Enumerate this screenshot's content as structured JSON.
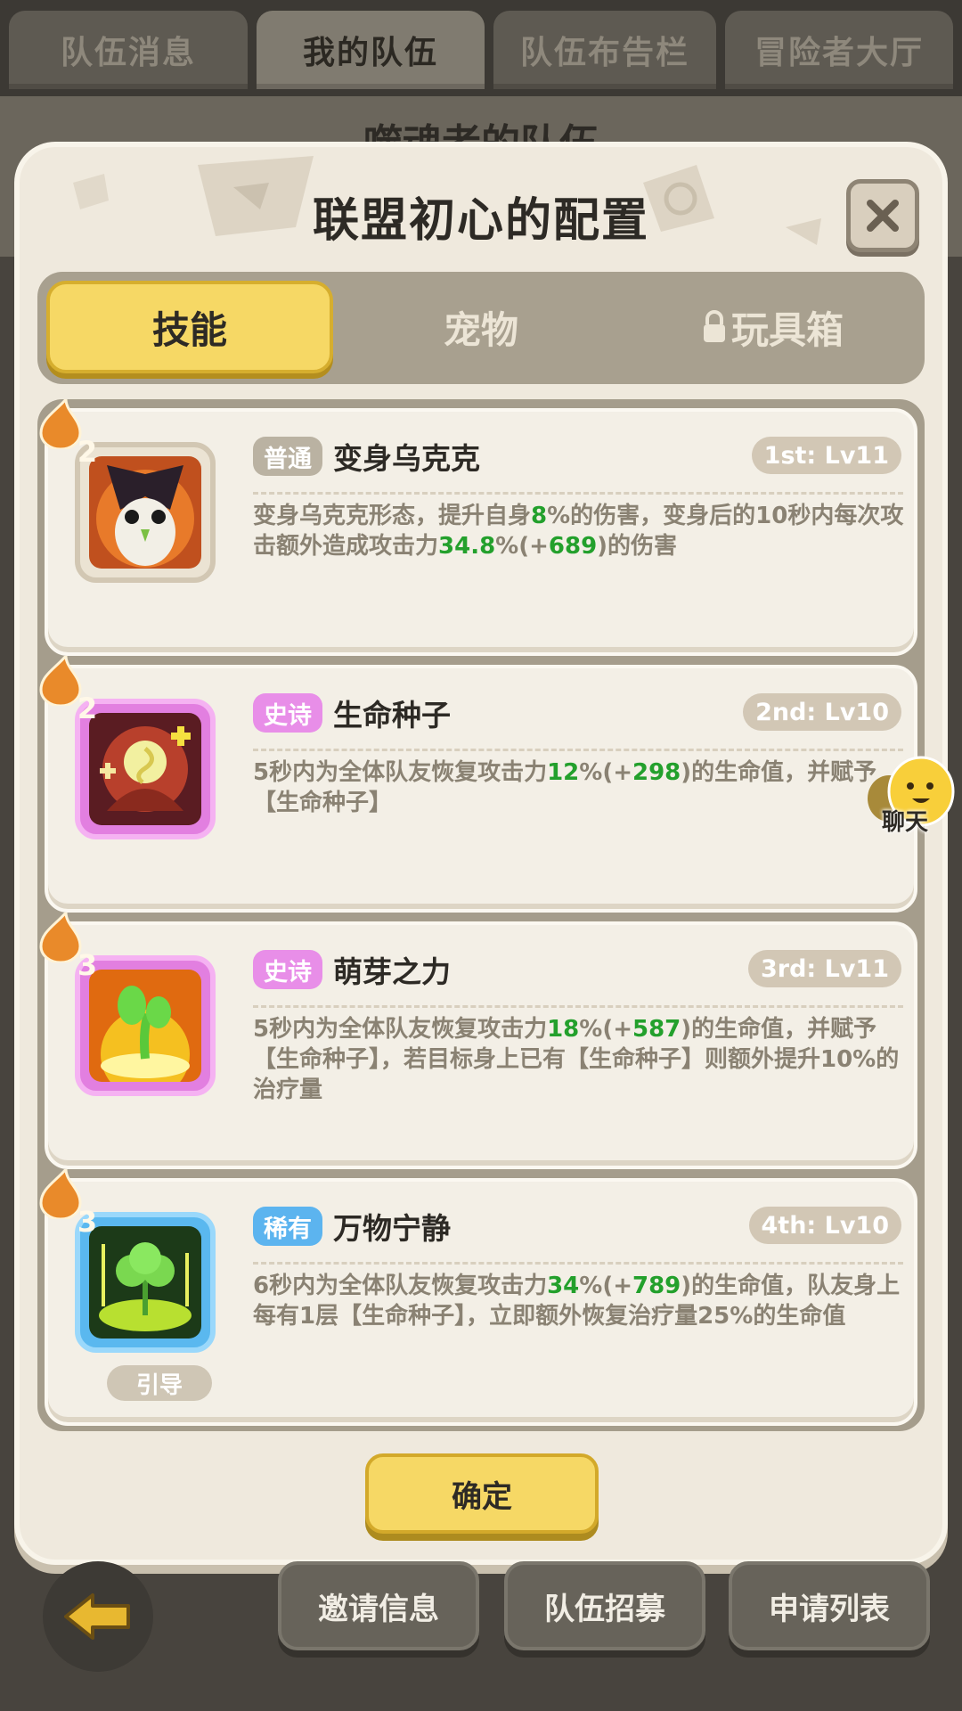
{
  "top_tabs": [
    {
      "label": "队伍消息",
      "active": false
    },
    {
      "label": "我的队伍",
      "active": true
    },
    {
      "label": "队伍布告栏",
      "active": false
    },
    {
      "label": "冒险者大厅",
      "active": false
    }
  ],
  "background_title": "噬魂者的队伍",
  "modal": {
    "title": "联盟初心的配置",
    "close_icon": "close-icon",
    "sub_tabs": [
      {
        "label": "技能",
        "active": true
      },
      {
        "label": "宠物",
        "active": false
      },
      {
        "label": "玩具箱",
        "active": false,
        "icon": "lock-icon"
      }
    ],
    "skills": [
      {
        "level": "2",
        "rarity": "普通",
        "rarity_type": "normal",
        "name": "变身乌克克",
        "order": "1st: Lv11",
        "desc": [
          {
            "t": "变身乌克克形态，提升自身",
            "g": false
          },
          {
            "t": "8",
            "g": true
          },
          {
            "t": "%的伤害，变身后的10秒内每次攻击额外造成攻击力",
            "g": false
          },
          {
            "t": "34.8",
            "g": true
          },
          {
            "t": "%(+",
            "g": false
          },
          {
            "t": "689",
            "g": true
          },
          {
            "t": ")的伤害",
            "g": false
          }
        ]
      },
      {
        "level": "2",
        "rarity": "史诗",
        "rarity_type": "epic",
        "name": "生命种子",
        "order": "2nd: Lv10",
        "desc": [
          {
            "t": "5秒内为全体队友恢复攻击力",
            "g": false
          },
          {
            "t": "12",
            "g": true
          },
          {
            "t": "%(+",
            "g": false
          },
          {
            "t": "298",
            "g": true
          },
          {
            "t": ")的生命值，并赋予【生命种子】",
            "g": false
          }
        ]
      },
      {
        "level": "3",
        "rarity": "史诗",
        "rarity_type": "epic",
        "name": "萌芽之力",
        "order": "3rd: Lv11",
        "desc": [
          {
            "t": "5秒内为全体队友恢复攻击力",
            "g": false
          },
          {
            "t": "18",
            "g": true
          },
          {
            "t": "%(+",
            "g": false
          },
          {
            "t": "587",
            "g": true
          },
          {
            "t": ")的生命值，并赋予【生命种子】，若目标身上已有【生命种子】则额外提升10%的治疗量",
            "g": false
          }
        ]
      },
      {
        "level": "3",
        "rarity": "稀有",
        "rarity_type": "rare",
        "name": "万物宁静",
        "order": "4th: Lv10",
        "guide": "引导",
        "desc": [
          {
            "t": "6秒内为全体队友恢复攻击力",
            "g": false
          },
          {
            "t": "34",
            "g": true
          },
          {
            "t": "%(+",
            "g": false
          },
          {
            "t": "789",
            "g": true
          },
          {
            "t": ")的生命值，队友身上每有1层【生命种子】，立即额外恢复治疗量25%的生命值",
            "g": false
          }
        ]
      }
    ],
    "confirm_label": "确定"
  },
  "chat_label": "聊天",
  "bottom_buttons": [
    {
      "label": "邀请信息"
    },
    {
      "label": "队伍招募"
    },
    {
      "label": "申请列表"
    }
  ],
  "back_icon": "back-arrow-icon",
  "colors": {
    "accent_yellow": "#f6d865",
    "highlight_green": "#23a02c",
    "epic_pink": "#e88ee8",
    "rare_blue": "#5cb4ef"
  }
}
